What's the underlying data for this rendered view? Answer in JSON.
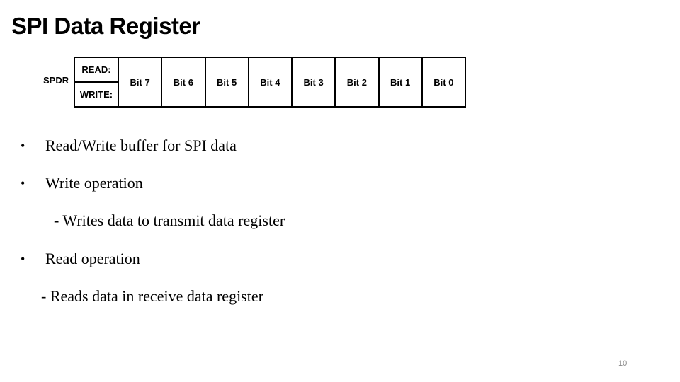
{
  "slide": {
    "title": "SPI Data Register",
    "page_number": "10"
  },
  "register": {
    "name": "SPDR",
    "read_label": "READ:",
    "write_label": "WRITE:",
    "bits": [
      "Bit 7",
      "Bit 6",
      "Bit 5",
      "Bit 4",
      "Bit 3",
      "Bit 2",
      "Bit 1",
      "Bit 0"
    ]
  },
  "content": {
    "bullets": [
      "Read/Write buffer for SPI data",
      "Write operation",
      "Read operation"
    ],
    "sub_items": [
      "- Writes data to transmit data register",
      "- Reads data in receive data register"
    ],
    "bullet_glyph": "•"
  }
}
